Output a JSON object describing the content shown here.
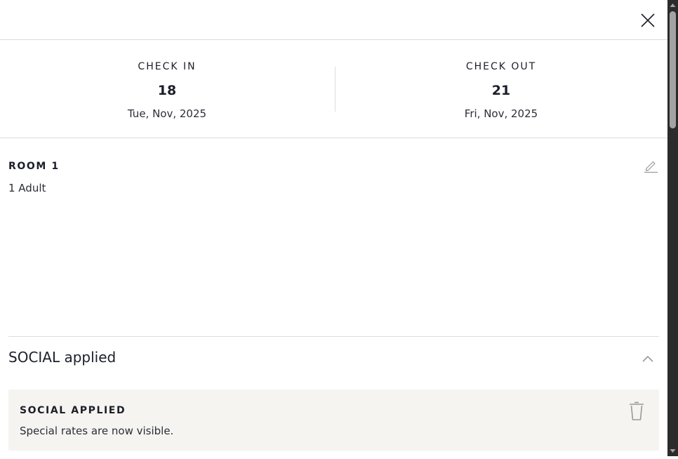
{
  "check_in": {
    "label": "CHECK IN",
    "day": "18",
    "sub": "Tue, Nov, 2025"
  },
  "check_out": {
    "label": "CHECK OUT",
    "day": "21",
    "sub": "Fri, Nov, 2025"
  },
  "room": {
    "title": "ROOM 1",
    "guests": "1 Adult"
  },
  "promo": {
    "header": "SOCIAL applied",
    "box_title": "SOCIAL APPLIED",
    "box_text": "Special rates are now visible."
  },
  "icons": {
    "close": "close-icon",
    "edit": "pencil-icon",
    "collapse": "chevron-up-icon",
    "remove": "trash-icon"
  },
  "colors": {
    "text": "#1c1f2a",
    "divider": "#dcdcdc",
    "promo_bg": "#f5f4f0",
    "icon_gray": "#9a9a9a"
  }
}
